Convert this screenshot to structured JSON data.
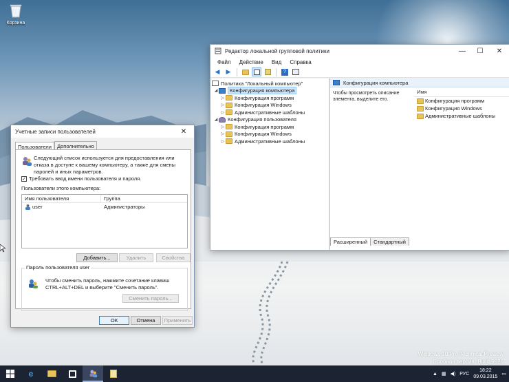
{
  "desktop": {
    "recycle_bin_label": "Корзина",
    "watermark_line1": "Windows 10 Pro Technical Preview",
    "watermark_line2": "Пробная версия. Build 9926"
  },
  "gpe": {
    "title": "Редактор локальной групповой политики",
    "menu": [
      "Файл",
      "Действие",
      "Вид",
      "Справка"
    ],
    "tree": [
      {
        "label": "Политика \"Локальный компьютер\"",
        "level": 0,
        "icon": "policy-icon"
      },
      {
        "label": "Конфигурация компьютера",
        "level": 1,
        "icon": "computer-icon",
        "expanded": true,
        "selected": true
      },
      {
        "label": "Конфигурация программ",
        "level": 2,
        "icon": "folder-icon"
      },
      {
        "label": "Конфигурация Windows",
        "level": 2,
        "icon": "folder-icon"
      },
      {
        "label": "Административные шаблоны",
        "level": 2,
        "icon": "folder-icon"
      },
      {
        "label": "Конфигурация пользователя",
        "level": 1,
        "icon": "user-icon",
        "expanded": true
      },
      {
        "label": "Конфигурация программ",
        "level": 2,
        "icon": "folder-icon"
      },
      {
        "label": "Конфигурация Windows",
        "level": 2,
        "icon": "folder-icon"
      },
      {
        "label": "Административные шаблоны",
        "level": 2,
        "icon": "folder-icon"
      }
    ],
    "right_header": "Конфигурация компьютера",
    "right_description": "Чтобы просмотреть описание элемента, выделите его.",
    "column_name": "Имя",
    "items": [
      "Конфигурация программ",
      "Конфигурация Windows",
      "Административные шаблоны"
    ],
    "tab_extended": "Расширенный",
    "tab_standard": "Стандартный"
  },
  "accounts": {
    "title": "Учетные записи пользователей",
    "tab_users": "Пользователи",
    "tab_advanced": "Дополнительно",
    "intro": "Следующий список используется для предоставления или отказа в доступе к вашему компьютеру, а также для смены паролей и иных параметров.",
    "require_login_label": "Требовать ввод имени пользователя и пароля.",
    "require_login_checked": true,
    "users_label": "Пользователи этого компьютера:",
    "col_username": "Имя пользователя",
    "col_group": "Группа",
    "users": [
      {
        "name": "user",
        "group": "Администраторы"
      }
    ],
    "btn_add": "Добавить...",
    "btn_remove": "Удалить",
    "btn_properties": "Свойства",
    "password_group_title": "Пароль пользователя user",
    "password_text": "Чтобы сменить пароль, нажмите сочетание клавиш CTRL+ALT+DEL и выберите \"Сменить пароль\".",
    "btn_change_password": "Сменить пароль...",
    "btn_ok": "ОК",
    "btn_cancel": "Отмена",
    "btn_apply": "Применить"
  },
  "taskbar": {
    "language": "РУС",
    "time": "18:22",
    "date": "09.03.2015"
  },
  "colors": {
    "taskbar": "#1c2434",
    "selection": "#cde6fb",
    "accent": "#3c7fb1"
  }
}
